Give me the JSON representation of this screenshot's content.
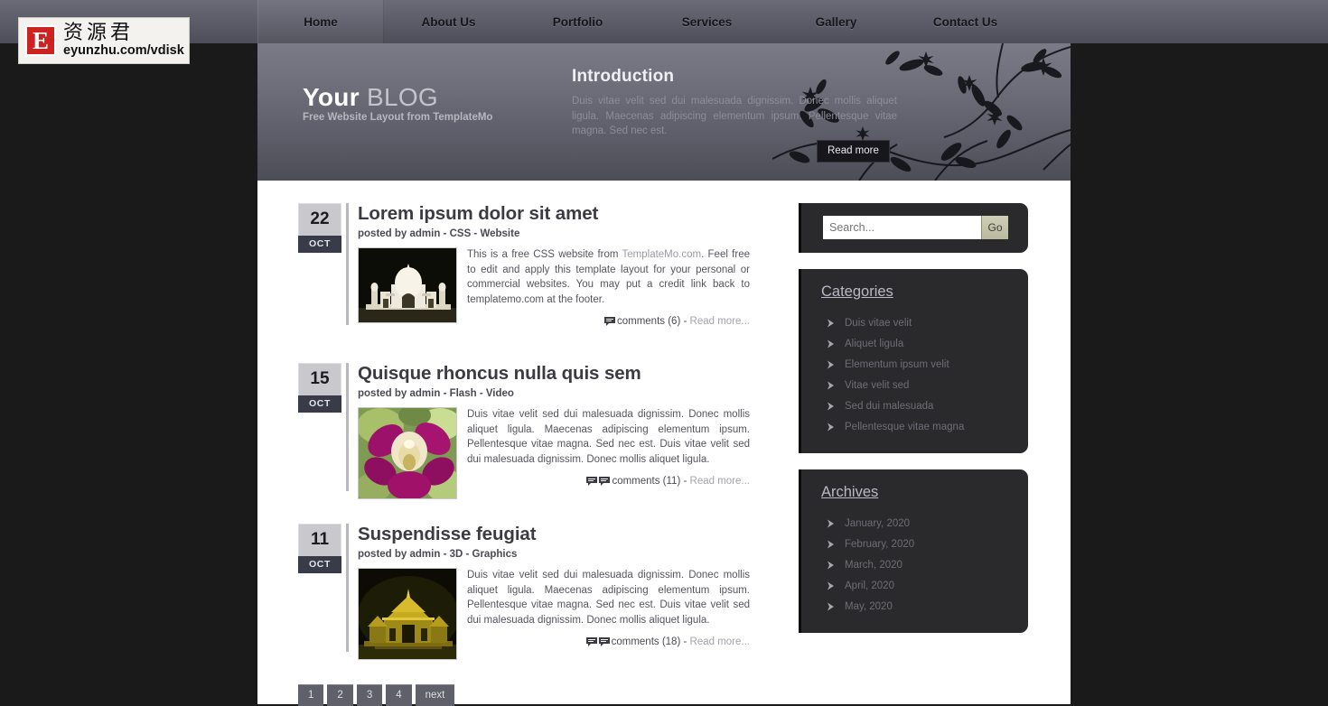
{
  "logo": {
    "letter": "E",
    "chinese": "资源君",
    "url": "eyunzhu.com/vdisk"
  },
  "nav": {
    "items": [
      {
        "label": "Home",
        "active": true
      },
      {
        "label": "About Us",
        "active": false
      },
      {
        "label": "Portfolio",
        "active": false
      },
      {
        "label": "Services",
        "active": false
      },
      {
        "label": "Gallery",
        "active": false
      },
      {
        "label": "Contact Us",
        "active": false
      }
    ]
  },
  "banner": {
    "title_strong": "Your",
    "title_light": "BLOG",
    "subtitle": "Free Website Layout from TemplateMo",
    "intro_heading": "Introduction",
    "intro_text": "Duis vitae velit sed dui malesuada dignissim. Donec mollis aliquet ligula. Maecenas adipiscing elementum ipsum. Pellentesque vitae magna. Sed nec est.",
    "read_more": "Read more"
  },
  "posts": [
    {
      "day": "22",
      "month": "OCT",
      "title": "Lorem ipsum dolor sit amet",
      "meta": "posted by admin - CSS - Website",
      "text_pre": "This is a free CSS website from ",
      "text_link": "TemplateMo.com",
      "text_post": ". Feel free to edit and apply this template layout for your personal or commercial websites. You may put a credit link back to templatemo.com at the footer.",
      "comments": "comments (6)",
      "separator": " - ",
      "read_more": "Read more...",
      "comment_icons": 1,
      "thumb_alt": "taj-mahal-photo"
    },
    {
      "day": "15",
      "month": "OCT",
      "title": "Quisque rhoncus nulla quis sem",
      "meta": "posted by admin - Flash - Video",
      "text_pre": "Duis vitae velit sed dui malesuada dignissim. Donec mollis aliquet ligula. Maecenas adipiscing elementum ipsum. Pellentesque vitae magna. Sed nec est. Duis vitae velit sed dui malesuada dignissim. Donec mollis aliquet ligula.",
      "text_link": "",
      "text_post": "",
      "comments": "comments (11)",
      "separator": " - ",
      "read_more": "Read more...",
      "comment_icons": 2,
      "thumb_alt": "purple-orchid-photo"
    },
    {
      "day": "11",
      "month": "OCT",
      "title": "Suspendisse feugiat",
      "meta": "posted by admin - 3D - Graphics",
      "text_pre": "Duis vitae velit sed dui malesuada dignissim. Donec mollis aliquet ligula. Maecenas adipiscing elementum ipsum. Pellentesque vitae magna. Sed nec est. Duis vitae velit sed dui malesuada dignissim. Donec mollis aliquet ligula.",
      "text_link": "",
      "text_post": "",
      "comments": "comments (18)",
      "separator": " - ",
      "read_more": "Read more...",
      "comment_icons": 2,
      "thumb_alt": "golden-thai-temple-photo"
    }
  ],
  "pagination": [
    {
      "label": "1"
    },
    {
      "label": "2"
    },
    {
      "label": "3"
    },
    {
      "label": "4"
    },
    {
      "label": "next"
    }
  ],
  "sidebar": {
    "search": {
      "placeholder": "Search...",
      "value": "",
      "button": "Go"
    },
    "categories": {
      "heading": "Categories",
      "items": [
        "Duis vitae velit",
        "Aliquet ligula",
        "Elementum ipsum velit",
        "Vitae velit sed",
        "Sed dui malesuada",
        "Pellentesque vitae magna"
      ]
    },
    "archives": {
      "heading": "Archives",
      "items": [
        "January, 2020",
        "February, 2020",
        "March, 2020",
        "April, 2020",
        "May, 2020"
      ]
    }
  },
  "colors": {
    "page_bg": "#1a1a1b",
    "nav_bg": "#5d5e6a",
    "banner_top": "#7a7b87",
    "content_bg": "#ffffff",
    "sidebar_box": "#2a2a2c",
    "sidebar_heading": "#b9b9c8",
    "date_day_bg": "#c9c9cd",
    "date_month_bg": "#3a3b48",
    "go_button": "#c3c3aa",
    "logo_red": "#cc2222"
  }
}
